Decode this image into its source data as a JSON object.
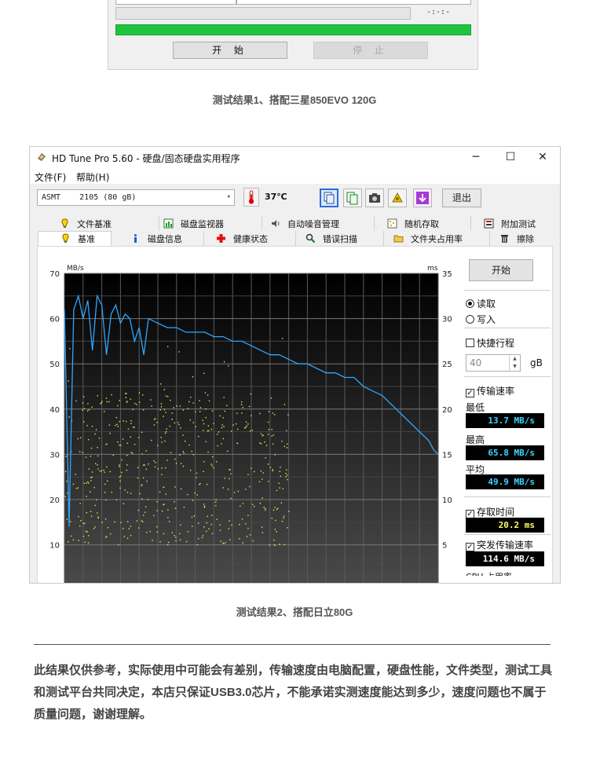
{
  "top_window": {
    "time_readout": "-:-:-",
    "start_button": "开 始",
    "stop_button": "停 止",
    "progress_percent": 100
  },
  "caption1": "测试结果1、搭配三星850EVO 120G",
  "caption2": "测试结果2、搭配日立80G",
  "window": {
    "title": "HD Tune Pro 5.60 - 硬盘/固态硬盘实用程序",
    "minimize_glyph": "─",
    "maximize_glyph": "☐",
    "close_glyph": "✕",
    "menu": {
      "file": "文件(F)",
      "help": "帮助(H)"
    },
    "drive": "ASMT    2105 (80 gB)",
    "temperature": "37℃",
    "exit_button": "退出",
    "tool_icons": [
      "copy-info-icon",
      "copy-icon",
      "camera-icon",
      "options-icon",
      "save-icon"
    ],
    "tabs_row1": [
      "文件基准",
      "磁盘监视器",
      "自动噪音管理",
      "随机存取",
      "附加测试"
    ],
    "tabs_row2": [
      "基准",
      "磁盘信息",
      "健康状态",
      "错误扫描",
      "文件夹占用率",
      "擦除"
    ]
  },
  "panel": {
    "start_button": "开始",
    "read_label": "读取",
    "write_label": "写入",
    "short_stroke_label": "快捷行程",
    "short_stroke_value": "40",
    "short_stroke_unit": "gB",
    "transfer_rate_label": "传输速率",
    "min_label": "最低",
    "min_value": "13.7 MB/s",
    "max_label": "最高",
    "max_value": "65.8 MB/s",
    "avg_label": "平均",
    "avg_value": "49.9 MB/s",
    "access_time_label": "存取时间",
    "access_time_value": "20.2 ms",
    "burst_label": "突发传输速率",
    "burst_value": "114.6 MB/s",
    "cpu_label": "CPU 占用率"
  },
  "chart_data": {
    "type": "line",
    "ylabel_left": "MB/s",
    "ylabel_right": "ms",
    "ylim_left": [
      0,
      70
    ],
    "ylim_right": [
      0,
      35
    ],
    "yticks_left": [
      "70",
      "60",
      "50",
      "40",
      "30",
      "20",
      "10"
    ],
    "yticks_right": [
      "35",
      "30",
      "25",
      "20",
      "15",
      "10",
      "5"
    ],
    "grid": true,
    "series": [
      {
        "values": [
          62,
          14,
          62,
          65,
          60,
          64,
          53,
          65,
          63,
          52,
          61,
          63,
          59,
          61,
          60,
          55,
          58,
          52,
          60,
          59,
          58,
          58,
          57,
          57,
          57,
          56,
          56,
          55,
          55,
          54,
          53,
          52,
          52,
          51,
          50,
          50,
          49,
          48,
          48,
          47,
          47,
          45,
          44,
          43,
          41,
          39,
          37,
          35,
          33,
          31,
          30
        ]
      }
    ],
    "x": [
      0,
      1,
      2,
      3,
      4,
      5,
      6,
      7,
      8,
      9,
      10,
      11,
      12,
      13,
      14,
      15,
      16,
      17,
      18,
      20,
      22,
      24,
      26,
      28,
      30,
      32,
      34,
      36,
      38,
      40,
      42,
      44,
      46,
      48,
      50,
      52,
      54,
      56,
      58,
      60,
      62,
      64,
      66,
      68,
      70,
      72,
      74,
      76,
      78,
      79,
      80
    ],
    "access_points_ms_note": "scatter of random access times between 5 and 28 ms"
  },
  "disclaimer": "此结果仅供参考，实际使用中可能会有差别，传输速度由电脑配置，硬盘性能，文件类型，测试工具和测试平台共同决定，本店只保证USB3.0芯片，不能承诺实测速度能达到多少，速度问题也不属于质量问题，谢谢理解。"
}
